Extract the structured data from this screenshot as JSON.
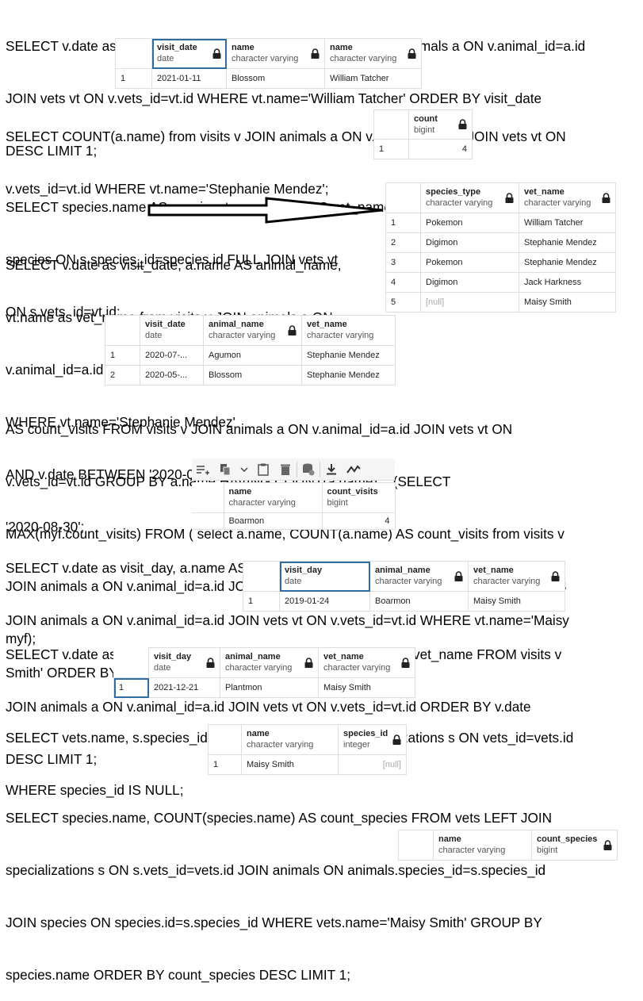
{
  "queries": {
    "q1": [
      "SELECT v.date as visit_date, a.name, vt.name from visits v JOIN animals a ON v.animal_id=a.id",
      "JOIN vets vt ON v.vets_id=vt.id WHERE vt.name='William Tatcher' ORDER BY visit_date",
      "DESC LIMIT 1;"
    ],
    "q2": [
      "SELECT COUNT(a.name) from visits v JOIN animals a ON v.animal  id=a.id JOIN vets vt ON",
      "v.vets_id=vt.id WHERE vt.name='Stephanie Mendez';"
    ],
    "q3": [
      "SELECT species.name AS species_type, vt.name AS vet_name from specializations s JOIN",
      "species ON s.species_id=species.id FULL JOIN vets vt",
      "ON s.vets  id=vt.id;"
    ],
    "q4": [
      "SELECT v.date as visit_date, a.name AS animal_name,",
      "vt.name as vet_name from visits v JOIN animals a ON",
      "v.animal_id=a.id JOIN vets vtON v.vets_id=vt.id",
      "WHERE vt.name='Stephanie Mendez'",
      "AND v.date BETWEEN '2020-04-01' AND",
      "'2020-08-30';"
    ],
    "q5": [
      "AS count_visits FROM visits v JOIN animals a ON v.animal_id=a.id JOIN vets vt ON",
      "v.vets_id=vt.id GROUP BY a.name HAVING COUNT(a.name) = (SELECT",
      "MAX(myf.count_visits) FROM ( select a.name, COUNT(a.name) AS count_visits from visits v",
      "JOIN animals a ON v.animal_id=a.id JOIN vets vt ON v.vets_id=vt.id GROUP BY a.name) AS",
      "myf);"
    ],
    "q6": [
      "SELECT v.date as visit_day, a.name AS animal_name, vt.name AS vet_nameFROM visits v",
      "JOIN animals a ON v.animal_id=a.id JOIN vets vt ON v.vets_id=vt.id WHERE vt.name='Maisy",
      "Smith' ORDER BY v.date LIMIT 1;"
    ],
    "q7": [
      "SELECT v.date as visit_day, a.name AS animal_name, vt.name AS vet_name FROM visits v",
      "JOIN animals a ON v.animal_id=a.id JOIN vets vt ON v.vets_id=vt.id ORDER BY v.date",
      "DESC LIMIT 1;"
    ],
    "q8": [
      "SELECT vets.name, s.species_id FROM vets LEFT JOIN specializations s ON vets_id=vets.id",
      "WHERE species_id IS NULL;"
    ],
    "q9": [
      "SELECT species.name, COUNT(species.name) AS count_species FROM vets LEFT JOIN",
      "specializations s ON s.vets_id=vets.id JOIN animals ON animals.species_id=s.species_id",
      "JOIN species ON species.id=s.species_id WHERE vets.name='Maisy Smith' GROUP BY",
      "species.name ORDER BY count_species DESC LIMIT 1;"
    ]
  },
  "results": {
    "r1": {
      "columns": [
        {
          "name": "visit_date",
          "type": "date"
        },
        {
          "name": "name",
          "type": "character varying"
        },
        {
          "name": "name",
          "type": "character varying"
        }
      ],
      "rows": [
        {
          "n": "1",
          "cells": [
            "2021-01-11",
            "Blossom",
            "William Tatcher"
          ]
        }
      ]
    },
    "r2": {
      "columns": [
        {
          "name": "count",
          "type": "bigint"
        }
      ],
      "rows": [
        {
          "n": "1",
          "cells": [
            "4"
          ]
        }
      ]
    },
    "r3": {
      "columns": [
        {
          "name": "species_type",
          "type": "character varying"
        },
        {
          "name": "vet_name",
          "type": "character varying"
        }
      ],
      "rows": [
        {
          "n": "1",
          "cells": [
            "Pokemon",
            "William Tatcher"
          ]
        },
        {
          "n": "2",
          "cells": [
            "Digimon",
            "Stephanie Mendez"
          ]
        },
        {
          "n": "3",
          "cells": [
            "Pokemon",
            "Stephanie Mendez"
          ]
        },
        {
          "n": "4",
          "cells": [
            "Digimon",
            "Jack Harkness"
          ]
        },
        {
          "n": "5",
          "cells": [
            "[null]",
            "Maisy Smith"
          ]
        }
      ]
    },
    "r4": {
      "columns": [
        {
          "name": "visit_date",
          "type": "date"
        },
        {
          "name": "animal_name",
          "type": "character varying"
        },
        {
          "name": "vet_name",
          "type": "character varying"
        }
      ],
      "rows": [
        {
          "n": "1",
          "cells": [
            "2020-07-...",
            "Agumon",
            "Stephanie Mendez"
          ]
        },
        {
          "n": "2",
          "cells": [
            "2020-05-...",
            "Blossom",
            "Stephanie Mendez"
          ]
        }
      ]
    },
    "r5": {
      "columns": [
        {
          "name": "name",
          "type": "character varying"
        },
        {
          "name": "count_visits",
          "type": "bigint"
        }
      ],
      "rows": [
        {
          "n": "1",
          "cells": [
            "Boarmon",
            "4"
          ]
        }
      ]
    },
    "r6": {
      "columns": [
        {
          "name": "visit_day",
          "type": "date"
        },
        {
          "name": "animal_name",
          "type": "character varying"
        },
        {
          "name": "vet_name",
          "type": "character varying"
        }
      ],
      "rows": [
        {
          "n": "1",
          "cells": [
            "2019-01-24",
            "Boarmon",
            "Maisy Smith"
          ]
        }
      ]
    },
    "r7": {
      "columns": [
        {
          "name": "visit_day",
          "type": "date"
        },
        {
          "name": "animal_name",
          "type": "character varying"
        },
        {
          "name": "vet_name",
          "type": "character varying"
        }
      ],
      "rows": [
        {
          "n": "1",
          "cells": [
            "2021-12-21",
            "Plantmon",
            "Maisy Smith"
          ]
        }
      ]
    },
    "r8": {
      "columns": [
        {
          "name": "name",
          "type": "character varying"
        },
        {
          "name": "species_id",
          "type": "integer"
        }
      ],
      "rows": [
        {
          "n": "1",
          "cells": [
            "Maisy Smith",
            "[null]"
          ]
        }
      ]
    },
    "r9": {
      "columns": [
        {
          "name": "name",
          "type": "character varying"
        },
        {
          "name": "count_species",
          "type": "bigint"
        }
      ],
      "rows": []
    }
  },
  "toolbar": {
    "icons": [
      "add-row-icon",
      "copy-icon",
      "dropdown-chevron-icon",
      "paste-icon",
      "delete-icon",
      "save-data-icon",
      "download-icon",
      "graph-icon"
    ]
  }
}
